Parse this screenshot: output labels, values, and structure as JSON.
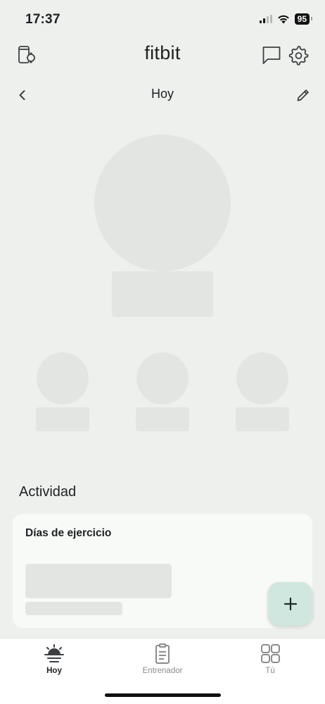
{
  "status_bar": {
    "time": "17:37",
    "battery": "95",
    "icons": [
      "cellular-signal-icon",
      "wifi-icon",
      "battery-icon"
    ]
  },
  "header": {
    "logo": "fitbit",
    "left_icon": "devices-icon",
    "right_icons": [
      "messages-icon",
      "settings-icon"
    ]
  },
  "subheader": {
    "title": "Hoy",
    "left_icon": "chevron-left-icon",
    "right_icon": "edit-pencil-icon"
  },
  "activity": {
    "section_title": "Actividad",
    "card_title": "Días de ejercicio"
  },
  "fab": {
    "icon": "add-icon"
  },
  "bottom_nav": {
    "items": [
      {
        "label": "Hoy",
        "icon": "today-sunrise-icon",
        "active": true
      },
      {
        "label": "Entrenador",
        "icon": "clipboard-icon",
        "active": false
      },
      {
        "label": "Tú",
        "icon": "grid-icon",
        "active": false
      }
    ]
  },
  "colors": {
    "background": "#eef0ee",
    "skeleton": "#e2e5e2",
    "card": "#f8faf8",
    "fab": "#cfe7df",
    "nav_active": "#202124",
    "nav_inactive": "#8a8d8a"
  }
}
